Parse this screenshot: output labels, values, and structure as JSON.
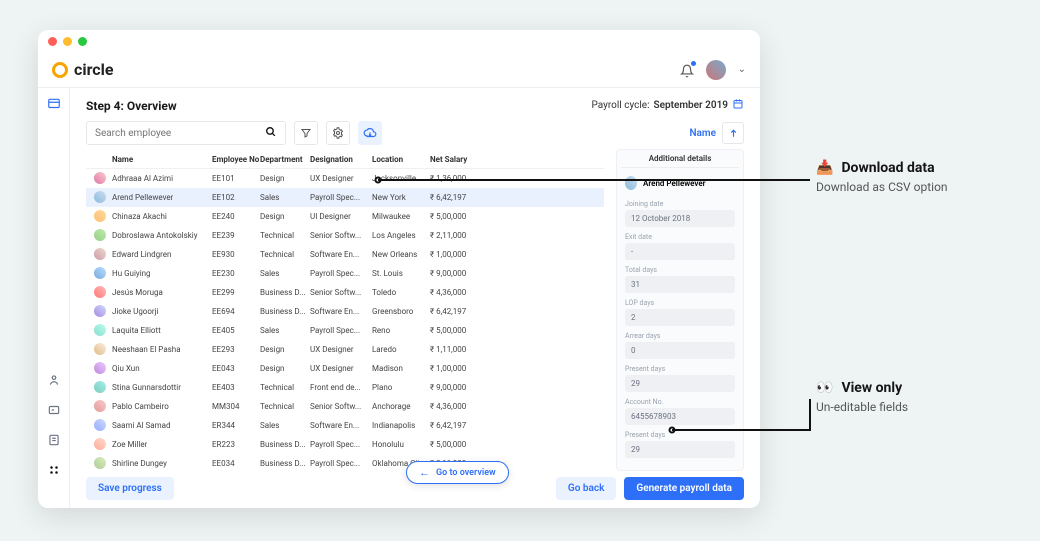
{
  "brand": "circle",
  "step_title": "Step 4: Overview",
  "cycle_label": "Payroll cycle:",
  "cycle_value": "September 2019",
  "search_placeholder": "Search employee",
  "sort_label": "Name",
  "columns": {
    "name": "Name",
    "emp": "Employee No",
    "dept": "Department",
    "desig": "Designation",
    "loc": "Location",
    "sal": "Net Salary"
  },
  "panel_header": "Additional details",
  "selected_person": "Arend Pellewever",
  "fields": {
    "joining": {
      "label": "Joining date",
      "value": "12 October 2018"
    },
    "exit": {
      "label": "Exit date",
      "value": "-"
    },
    "total": {
      "label": "Total days",
      "value": "31"
    },
    "lop": {
      "label": "LOP days",
      "value": "2"
    },
    "arrear": {
      "label": "Arrear days",
      "value": "0"
    },
    "present": {
      "label": "Present days",
      "value": "29"
    },
    "account": {
      "label": "Account No.",
      "value": "6455678903"
    },
    "present2": {
      "label": "Present days",
      "value": "29"
    }
  },
  "popover": "Go to overview",
  "footer": {
    "save": "Save progress",
    "back": "Go back",
    "generate": "Generate payroll data"
  },
  "rows": [
    {
      "name": "Adhraaa Al Azimi",
      "emp": "EE101",
      "dept": "Design",
      "desig": "UX Designer",
      "loc": "Jacksonville",
      "sal": "₹ 1,36,000"
    },
    {
      "name": "Arend Pellewever",
      "emp": "EE102",
      "dept": "Sales",
      "desig": "Payroll Spec...",
      "loc": "New York",
      "sal": "₹ 6,42,197",
      "selected": true
    },
    {
      "name": "Chinaza Akachi",
      "emp": "EE240",
      "dept": "Design",
      "desig": "UI Designer",
      "loc": "Milwaukee",
      "sal": "₹ 5,00,000"
    },
    {
      "name": "Dobroslawa Antokolskiy",
      "emp": "EE239",
      "dept": "Technical",
      "desig": "Senior Softw...",
      "loc": "Los Angeles",
      "sal": "₹ 2,11,000"
    },
    {
      "name": "Edward Lindgren",
      "emp": "EE930",
      "dept": "Technical",
      "desig": "Software En...",
      "loc": "New Orleans",
      "sal": "₹ 1,00,000"
    },
    {
      "name": "Hu Guiying",
      "emp": "EE230",
      "dept": "Sales",
      "desig": "Payroll Spec...",
      "loc": "St. Louis",
      "sal": "₹ 9,00,000"
    },
    {
      "name": "Jesús Moruga",
      "emp": "EE299",
      "dept": "Business D...",
      "desig": "Senior Softw...",
      "loc": "Toledo",
      "sal": "₹ 4,36,000"
    },
    {
      "name": "Jioke Ugoorji",
      "emp": "EE694",
      "dept": "Business D...",
      "desig": "Software En...",
      "loc": "Greensboro",
      "sal": "₹ 6,42,197"
    },
    {
      "name": "Laquita Elliott",
      "emp": "EE405",
      "dept": "Sales",
      "desig": "Payroll Spec...",
      "loc": "Reno",
      "sal": "₹ 5,00,000"
    },
    {
      "name": "Neeshaan El Pasha",
      "emp": "EE293",
      "dept": "Design",
      "desig": "UX Designer",
      "loc": "Laredo",
      "sal": "₹ 1,11,000"
    },
    {
      "name": "Qiu Xun",
      "emp": "EE043",
      "dept": "Design",
      "desig": "UX Designer",
      "loc": "Madison",
      "sal": "₹ 1,00,000"
    },
    {
      "name": "Stina Gunnarsdottir",
      "emp": "EE403",
      "dept": "Technical",
      "desig": "Front end de...",
      "loc": "Plano",
      "sal": "₹ 9,00,000"
    },
    {
      "name": "Pablo Cambeiro",
      "emp": "MM304",
      "dept": "Technical",
      "desig": "Senior Softw...",
      "loc": "Anchorage",
      "sal": "₹ 4,36,000"
    },
    {
      "name": "Saami Al Samad",
      "emp": "ER344",
      "dept": "Sales",
      "desig": "Software En...",
      "loc": "Indianapolis",
      "sal": "₹ 6,42,197"
    },
    {
      "name": "Zoe Miller",
      "emp": "ER223",
      "dept": "Business D...",
      "desig": "Payroll Spec...",
      "loc": "Honolulu",
      "sal": "₹ 5,00,000"
    },
    {
      "name": "Shirline Dungey",
      "emp": "EE034",
      "dept": "Business D...",
      "desig": "Payroll Spec...",
      "loc": "Oklahoma City",
      "sal": "₹ 2,11,000"
    }
  ],
  "callouts": {
    "download": {
      "emoji": "📥",
      "title": "Download data",
      "sub": "Download as CSV option"
    },
    "viewonly": {
      "emoji": "👀",
      "title": "View only",
      "sub": "Un-editable fields"
    }
  }
}
